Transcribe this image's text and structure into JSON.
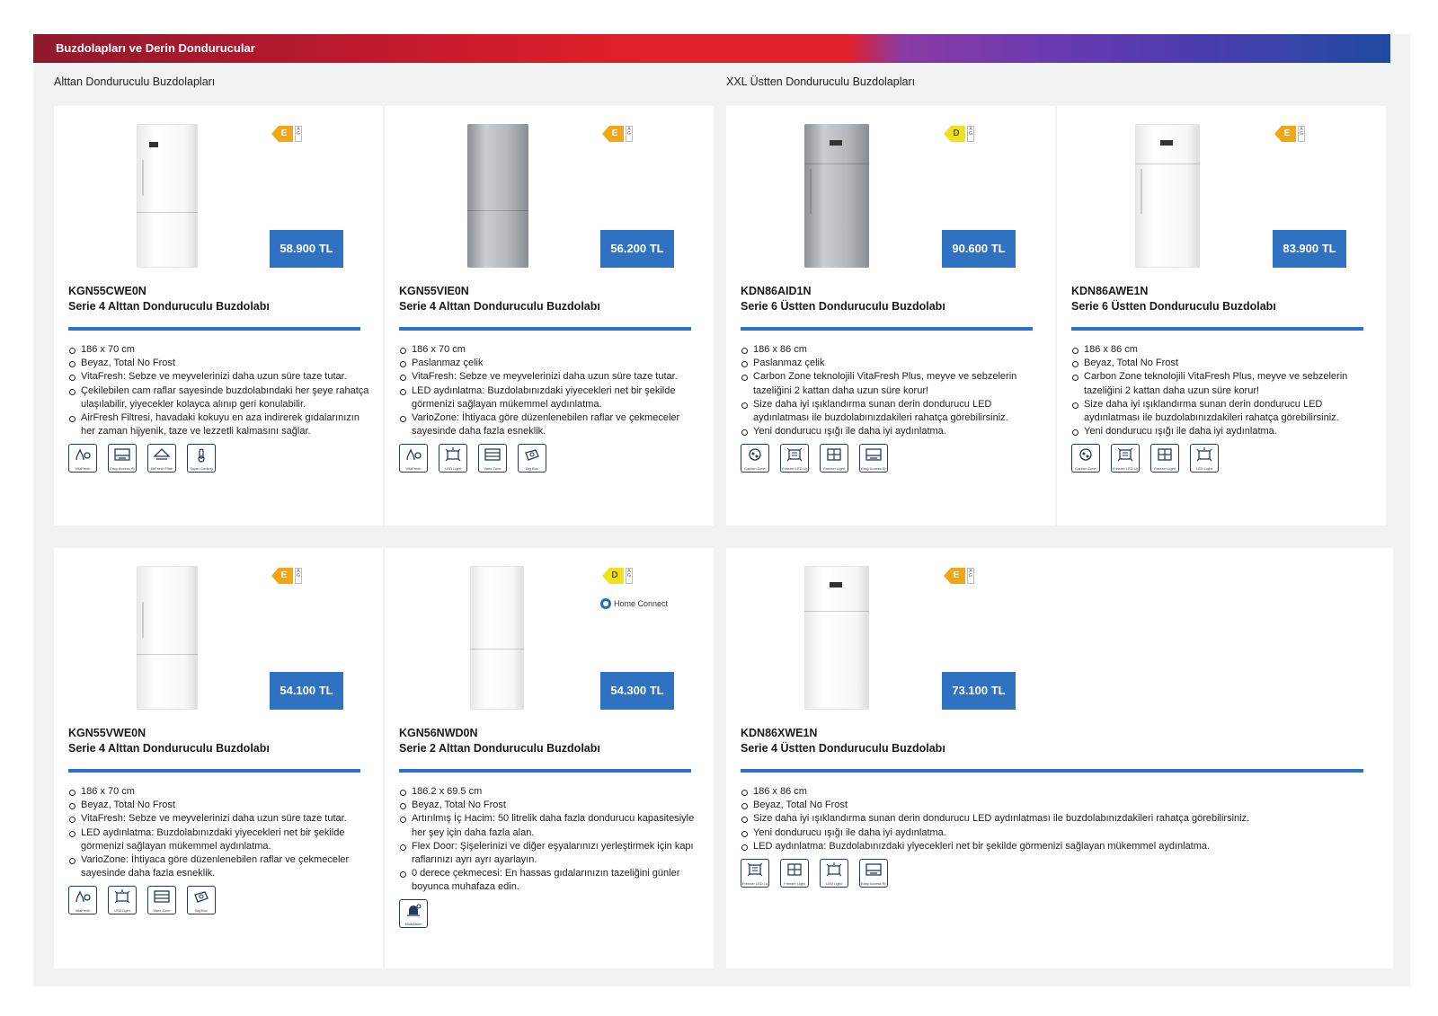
{
  "banner": {
    "title": "Buzdolapları ve Derin Dondurucular"
  },
  "sections": [
    {
      "title": "Alttan Donduruculu Buzdolapları"
    },
    {
      "title": "XXL Üstten Donduruculu Buzdolapları"
    }
  ],
  "products": [
    {
      "model": "KGN55CWE0N",
      "subtitle": "Serie 4 Alttan Donduruculu Buzdolabı",
      "price": "58.900 TL",
      "energy_class": "E",
      "energy_scale": "A\nG",
      "specs": [
        "186 x 70 cm",
        "Beyaz, Total No Frost",
        "VitaFresh: Sebze ve meyvelerinizi daha uzun süre taze tutar.",
        "Çekilebilen cam raflar sayesinde buzdolabındaki her şeye rahatça ulaşılabilir, yiyecekler kolayca alınıp geri konulabilir.",
        "AirFresh Filtresi, havadaki kokuyu en aza indirerek gıdalarınızın her zaman hijyenik, taze ve lezzetli kalmasını sağlar."
      ],
      "features": [
        {
          "icon": "vitafresh-icon",
          "caption": "VitaFresh"
        },
        {
          "icon": "easy-access-shelf-icon",
          "caption": "Easy Access Shelf"
        },
        {
          "icon": "airfresh-filter-icon",
          "caption": "AirFresh Filter"
        },
        {
          "icon": "super-cooling-icon",
          "caption": "Super Cooling"
        }
      ]
    },
    {
      "model": "KGN55VIE0N",
      "subtitle": "Serie 4 Alttan Donduruculu Buzdolabı",
      "price": "56.200 TL",
      "energy_class": "E",
      "energy_scale": "A\nG",
      "specs": [
        "186 x 70 cm",
        "Paslanmaz çelik",
        "VitaFresh: Sebze ve meyvelerinizi daha uzun süre taze tutar.",
        "LED aydınlatma: Buzdolabınızdaki yiyecekleri net bir şekilde görmenizi sağlayan mükemmel aydınlatma.",
        "VarioZone: İhtiyaca göre düzenlenebilen raflar ve çekmeceler sayesinde daha fazla esneklik."
      ],
      "features": [
        {
          "icon": "vitafresh-icon",
          "caption": "VitaFresh"
        },
        {
          "icon": "led-light-icon",
          "caption": "LED Light"
        },
        {
          "icon": "variozone-icon",
          "caption": "Vario Zone"
        },
        {
          "icon": "bigbox-icon",
          "caption": "Big Box"
        }
      ]
    },
    {
      "model": "KDN86AID1N",
      "subtitle": "Serie 6 Üstten Donduruculu Buzdolabı",
      "price": "90.600 TL",
      "energy_class": "D",
      "energy_scale": "A\nG",
      "specs": [
        "186 x 86 cm",
        "Paslanmaz çelik",
        "Carbon Zone teknolojili VitaFresh Plus, meyve ve sebzelerin tazeliğini 2 kattan daha uzun süre korur!",
        "Size daha iyi ışıklandırma sunan derin dondurucu LED aydınlatması ile buzdolabınızdakileri rahatça görebilirsiniz.",
        "Yeni dondurucu ışığı ile daha iyi aydınlatma."
      ],
      "features": [
        {
          "icon": "carbon-zone-icon",
          "caption": "Carbon Zone"
        },
        {
          "icon": "freezer-led-icon",
          "caption": "Freezer LED Light"
        },
        {
          "icon": "freezer-light-icon",
          "caption": "Freezer Light"
        },
        {
          "icon": "easy-access-shelf-icon",
          "caption": "Easy Access Shelf"
        }
      ]
    },
    {
      "model": "KDN86AWE1N",
      "subtitle": "Serie 6 Üstten Donduruculu Buzdolabı",
      "price": "83.900 TL",
      "energy_class": "E",
      "energy_scale": "A\nG",
      "specs": [
        "186 x 86 cm",
        "Beyaz, Total No Frost",
        "Carbon Zone teknolojili VitaFresh Plus, meyve ve sebzelerin tazeliğini 2 kattan daha uzun süre korur!",
        "Size daha iyi ışıklandırma sunan derin dondurucu LED aydınlatması ile buzdolabınızdakileri rahatça görebilirsiniz.",
        "Yeni dondurucu ışığı ile daha iyi aydınlatma."
      ],
      "features": [
        {
          "icon": "carbon-zone-icon",
          "caption": "Carbon Zone"
        },
        {
          "icon": "freezer-led-icon",
          "caption": "Freezer LED Light"
        },
        {
          "icon": "freezer-light-icon",
          "caption": "Freezer Light"
        },
        {
          "icon": "led-light-icon",
          "caption": "LED Light"
        }
      ]
    },
    {
      "model": "KGN55VWE0N",
      "subtitle": "Serie 4 Alttan Donduruculu Buzdolabı",
      "price": "54.100 TL",
      "energy_class": "E",
      "energy_scale": "A\nG",
      "specs": [
        "186 x 70 cm",
        "Beyaz, Total No Frost",
        "VitaFresh: Sebze ve meyvelerinizi daha uzun süre taze tutar.",
        "LED aydınlatma: Buzdolabınızdaki yiyecekleri net bir şekilde görmenizi sağlayan mükemmel aydınlatma.",
        "VarioZone: İhtiyaca göre düzenlenebilen raflar ve çekmeceler sayesinde daha fazla esneklik."
      ],
      "features": [
        {
          "icon": "vitafresh-icon",
          "caption": "VitaFresh"
        },
        {
          "icon": "led-light-icon",
          "caption": "LED Light"
        },
        {
          "icon": "variozone-icon",
          "caption": "Vario Zone"
        },
        {
          "icon": "bigbox-icon",
          "caption": "Big Box"
        }
      ]
    },
    {
      "model": "KGN56NWD0N",
      "subtitle": "Serie 2 Alttan Donduruculu Buzdolabı",
      "price": "54.300 TL",
      "energy_class": "D",
      "energy_scale": "A\nG",
      "home_connect": "Home Connect",
      "specs": [
        "186.2 x 69.5 cm",
        "Beyaz, Total No Frost",
        "Artırılmış İç Hacim: 50 litrelik daha fazla dondurucu kapasitesiyle her şey için daha fazla alan.",
        "Flex Door: Şişelerinizi ve diğer eşyalarınızı yerleştirmek için kapı raflarınızı ayrı ayrı ayarlayın.",
        "0 derece çekmecesi: En hassas gıdalarınızın tazeliğini günler boyunca muhafaza edin."
      ],
      "features": [
        {
          "icon": "multialarm-icon",
          "caption": "MultiAlarm"
        }
      ]
    },
    {
      "model": "KDN86XWE1N",
      "subtitle": "Serie 4 Üstten Donduruculu Buzdolabı",
      "price": "73.100 TL",
      "energy_class": "E",
      "energy_scale": "A\nG",
      "specs": [
        "186 x 86 cm",
        "Beyaz, Total No Frost",
        "Size daha iyi ışıklandırma sunan derin dondurucu LED aydınlatması ile buzdolabınızdakileri rahatça görebilirsiniz.",
        "Yeni dondurucu ışığı ile daha iyi aydınlatma.",
        "LED aydınlatma: Buzdolabınızdaki yiyecekleri net bir şekilde görmenizi sağlayan mükemmel aydınlatma."
      ],
      "features": [
        {
          "icon": "freezer-led-icon",
          "caption": "Freezer LED Light"
        },
        {
          "icon": "freezer-light-icon",
          "caption": "Freezer Light"
        },
        {
          "icon": "led-light-icon",
          "caption": "LED Light"
        },
        {
          "icon": "easy-access-shelf-icon",
          "caption": "Easy Access Shelf"
        }
      ]
    }
  ]
}
